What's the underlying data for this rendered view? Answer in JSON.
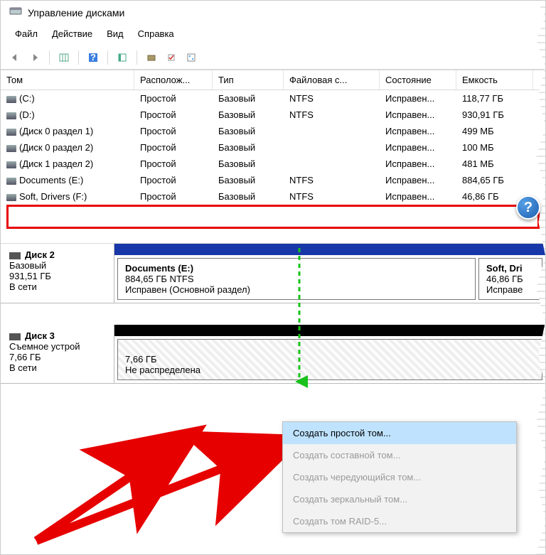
{
  "window": {
    "title": "Управление дисками"
  },
  "menu": {
    "file": "Файл",
    "action": "Действие",
    "view": "Вид",
    "help": "Справка"
  },
  "columns": {
    "tom": "Том",
    "loc": "Располож...",
    "typ": "Тип",
    "fs": "Файловая с...",
    "state": "Состояние",
    "cap": "Емкость"
  },
  "volumes": [
    {
      "name": "(C:)",
      "loc": "Простой",
      "typ": "Базовый",
      "fs": "NTFS",
      "state": "Исправен...",
      "cap": "118,77 ГБ"
    },
    {
      "name": "(D:)",
      "loc": "Простой",
      "typ": "Базовый",
      "fs": "NTFS",
      "state": "Исправен...",
      "cap": "930,91 ГБ"
    },
    {
      "name": "(Диск 0 раздел 1)",
      "loc": "Простой",
      "typ": "Базовый",
      "fs": "",
      "state": "Исправен...",
      "cap": "499 МБ"
    },
    {
      "name": "(Диск 0 раздел 2)",
      "loc": "Простой",
      "typ": "Базовый",
      "fs": "",
      "state": "Исправен...",
      "cap": "100 МБ"
    },
    {
      "name": "(Диск 1 раздел 2)",
      "loc": "Простой",
      "typ": "Базовый",
      "fs": "",
      "state": "Исправен...",
      "cap": "481 МБ"
    },
    {
      "name": "Documents (E:)",
      "loc": "Простой",
      "typ": "Базовый",
      "fs": "NTFS",
      "state": "Исправен...",
      "cap": "884,65 ГБ"
    },
    {
      "name": "Soft, Drivers (F:)",
      "loc": "Простой",
      "typ": "Базовый",
      "fs": "NTFS",
      "state": "Исправен...",
      "cap": "46,86 ГБ"
    }
  ],
  "disk2": {
    "label": "Диск 2",
    "type": "Базовый",
    "size": "931,51 ГБ",
    "status": "В сети",
    "vol1": {
      "name": "Documents  (E:)",
      "info": "884,65 ГБ NTFS",
      "state": "Исправен (Основной раздел)"
    },
    "vol2": {
      "name": "Soft, Dri",
      "info": "46,86 ГБ",
      "state": "Исправе"
    }
  },
  "disk3": {
    "label": "Диск 3",
    "type": "Съемное устрой",
    "size": "7,66 ГБ",
    "status": "В сети",
    "vol1": {
      "info": "7,66 ГБ",
      "state": "Не распределена"
    }
  },
  "ctx": {
    "simple": "Создать простой том...",
    "spanned": "Создать составной том...",
    "striped": "Создать чередующийся том...",
    "mirror": "Создать зеркальный том...",
    "raid5": "Создать том RAID-5..."
  },
  "qmark": "?"
}
